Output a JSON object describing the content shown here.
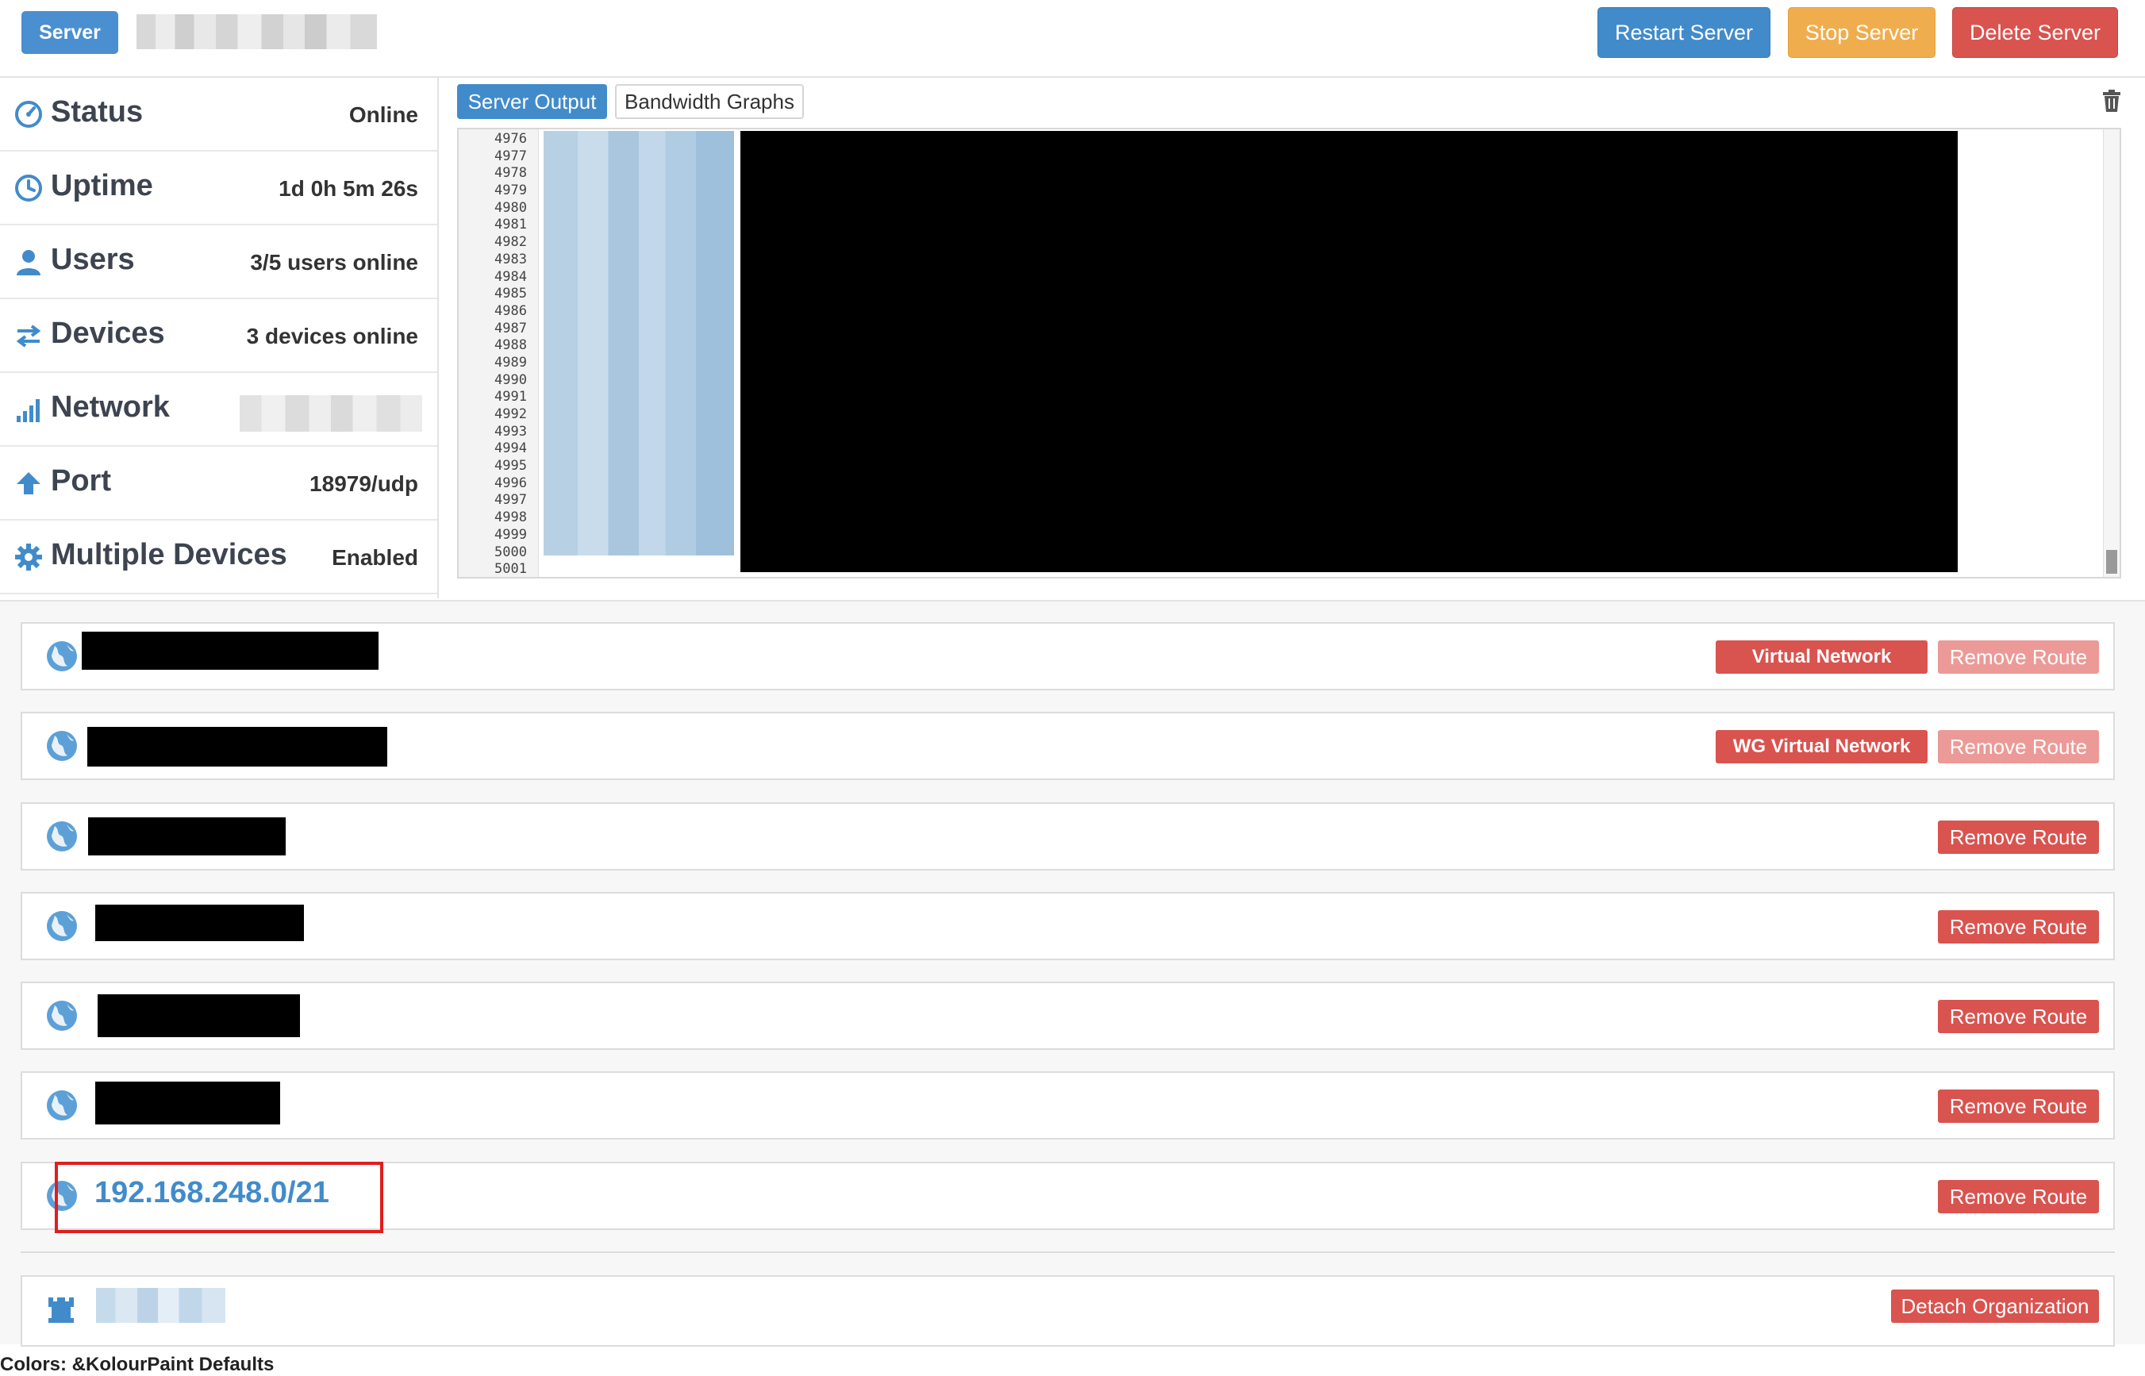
{
  "topbar": {
    "server_tag": "Server",
    "restart_label": "Restart Server",
    "stop_label": "Stop Server",
    "delete_label": "Delete Server"
  },
  "stats": {
    "status": {
      "label": "Status",
      "value": "Online"
    },
    "uptime": {
      "label": "Uptime",
      "value": "1d 0h 5m 26s"
    },
    "users": {
      "label": "Users",
      "value": "3/5 users online"
    },
    "devices": {
      "label": "Devices",
      "value": "3 devices online"
    },
    "network": {
      "label": "Network"
    },
    "port": {
      "label": "Port",
      "value": "18979/udp"
    },
    "multiple_devices": {
      "label": "Multiple Devices",
      "value": "Enabled"
    }
  },
  "output": {
    "tabs": [
      "Server Output",
      "Bandwidth Graphs"
    ],
    "line_numbers": [
      "4976",
      "4977",
      "4978",
      "4979",
      "4980",
      "4981",
      "4982",
      "4983",
      "4984",
      "4985",
      "4986",
      "4987",
      "4988",
      "4989",
      "4990",
      "4991",
      "4992",
      "4993",
      "4994",
      "4995",
      "4996",
      "4997",
      "4998",
      "4999",
      "5000",
      "5001"
    ]
  },
  "routes": {
    "virtual_network_label": "Virtual Network",
    "wg_virtual_network_label": "WG Virtual Network",
    "remove_route_label": "Remove Route",
    "visible_route": "192.168.248.0/21"
  },
  "organization": {
    "detach_label": "Detach Organization"
  },
  "footer": {
    "text": "Colors: &KolourPaint Defaults"
  },
  "colors": {
    "primary": "#428bca",
    "warning": "#f0ad4e",
    "danger": "#d9534f",
    "highlight": "#e01e1e"
  }
}
